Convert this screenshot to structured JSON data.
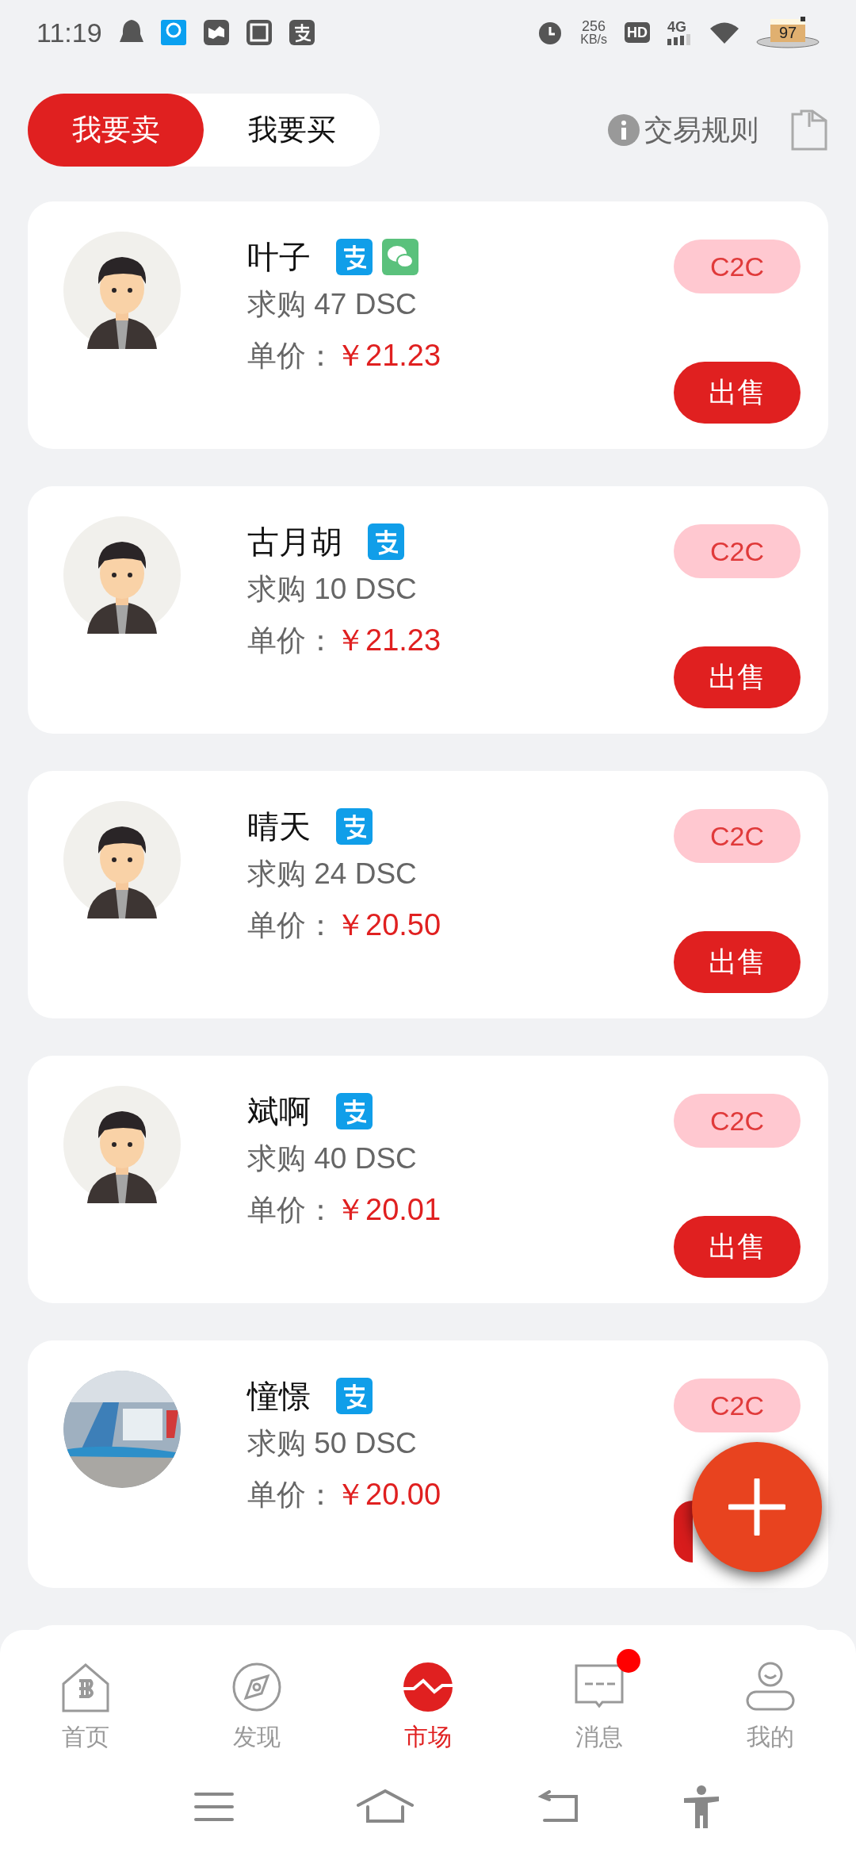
{
  "status_bar": {
    "time": "11:19",
    "speed_value": "256",
    "speed_unit": "KB/s",
    "hd": "HD",
    "network": "4G",
    "battery": "97"
  },
  "tabs": [
    {
      "label": "我要卖",
      "selected": true
    },
    {
      "label": "我要买",
      "selected": false
    }
  ],
  "rules_link": "交易规则",
  "orders": [
    {
      "name": "叶子",
      "payments": [
        {
          "kind": "alipay"
        },
        {
          "kind": "wechat"
        }
      ],
      "amount": "求购 47 DSC",
      "price_label": "单价：",
      "price": "￥21.23",
      "badge": "C2C",
      "action": "出售",
      "avatar": {
        "kind": "cartoon"
      }
    },
    {
      "name": "古月胡",
      "payments": [
        {
          "kind": "alipay"
        }
      ],
      "amount": "求购 10 DSC",
      "price_label": "单价：",
      "price": "￥21.23",
      "badge": "C2C",
      "action": "出售",
      "avatar": {
        "kind": "cartoon"
      }
    },
    {
      "name": "晴天",
      "payments": [
        {
          "kind": "alipay"
        }
      ],
      "amount": "求购 24 DSC",
      "price_label": "单价：",
      "price": "￥20.50",
      "badge": "C2C",
      "action": "出售",
      "avatar": {
        "kind": "cartoon"
      }
    },
    {
      "name": "斌啊",
      "payments": [
        {
          "kind": "alipay"
        }
      ],
      "amount": "求购 40 DSC",
      "price_label": "单价：",
      "price": "￥20.01",
      "badge": "C2C",
      "action": "出售",
      "avatar": {
        "kind": "cartoon"
      }
    },
    {
      "name": "憧憬",
      "payments": [
        {
          "kind": "alipay"
        }
      ],
      "amount": "求购 50 DSC",
      "price_label": "单价：",
      "price": "￥20.00",
      "badge": "C2C",
      "avatar": {
        "kind": "picture"
      }
    }
  ],
  "bottom_nav": [
    {
      "label": "首页",
      "kind": "home",
      "selected": false,
      "badge": false
    },
    {
      "label": "发现",
      "kind": "compass",
      "selected": false,
      "badge": false
    },
    {
      "label": "市场",
      "kind": "market",
      "selected": true,
      "badge": false
    },
    {
      "label": "消息",
      "kind": "message",
      "selected": false,
      "badge": true
    },
    {
      "label": "我的",
      "kind": "profile",
      "selected": false,
      "badge": false
    }
  ]
}
